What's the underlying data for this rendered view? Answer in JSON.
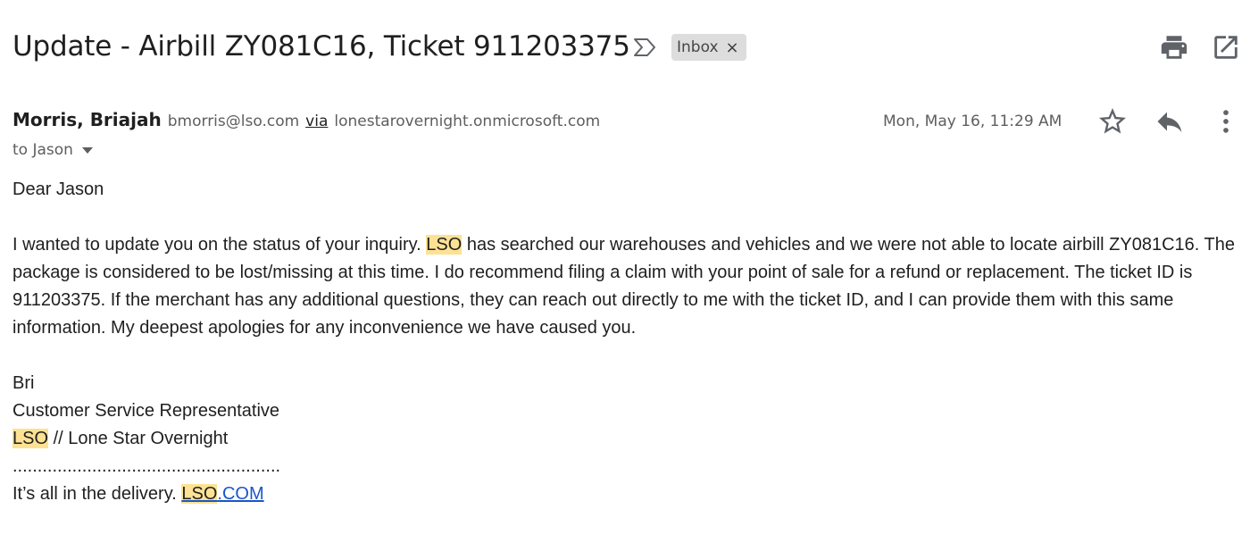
{
  "email": {
    "subject": "Update - Airbill ZY081C16, Ticket 911203375",
    "label": "Inbox",
    "label_remove_glyph": "×",
    "sender": {
      "name": "Morris, Briajah",
      "email": "bmorris@lso.com",
      "via_word": "via",
      "via_domain": "lonestarovernight.onmicrosoft.com"
    },
    "recipients": "to Jason",
    "timestamp": "Mon, May 16, 11:29 AM",
    "body": {
      "greeting": "Dear Jason",
      "para_start": "I wanted to update you on the status of your inquiry. ",
      "para_highlight": "LSO",
      "para_rest": " has searched our warehouses and vehicles and we were not able to locate airbill ZY081C16. The package is considered to be lost/missing at this time. I do recommend filing a claim with your point of sale for a refund or replacement. The ticket ID is 911203375. If the merchant has any additional questions, they can reach out directly to me with the ticket ID, and I can provide them with this same information. My deepest apologies for any inconvenience we have caused you.",
      "signature": {
        "name": "Bri",
        "title": "Customer Service Representative",
        "company_highlight": "LSO",
        "company_rest": " // Lone Star Overnight",
        "divider": "......................................................",
        "tagline": "It’s all in the delivery. ",
        "link_highlight": "LSO",
        "link_rest": ".COM"
      }
    }
  },
  "icons": {
    "importance": "importance-marker-icon",
    "print": "print-icon",
    "new_window": "open-in-new-window-icon",
    "star": "star-icon",
    "reply": "reply-icon",
    "more": "more-vertical-icon",
    "dropdown": "chevron-down-icon"
  },
  "colors": {
    "highlight": "#fde293",
    "link": "#1a56c7",
    "label_chip": "#dddddd",
    "icon": "#5f6368"
  }
}
